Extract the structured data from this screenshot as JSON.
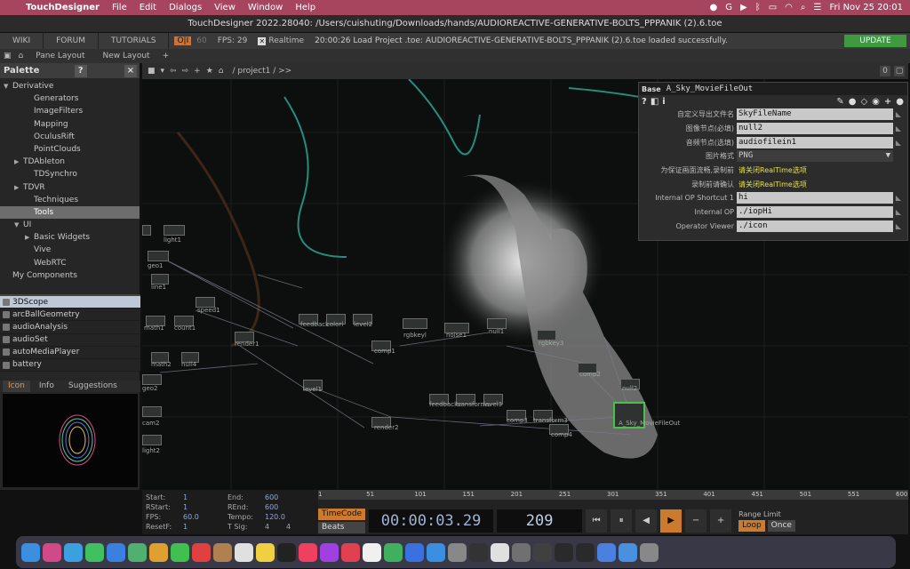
{
  "menubar": {
    "app_name": "TouchDesigner",
    "menus": [
      "File",
      "Edit",
      "Dialogs",
      "View",
      "Window",
      "Help"
    ],
    "clock": "Fri Nov 25  20:01"
  },
  "window": {
    "title": "TouchDesigner 2022.28040: /Users/cuishuting/Downloads/hands/AUDIOREACTIVE-GENERATIVE-BOLTS_PPPANIK (2).6.toe"
  },
  "topbar": {
    "tabs": [
      "WIKI",
      "FORUM",
      "TUTORIALS"
    ],
    "oi_label": "O|I",
    "fps_target": "60",
    "fps_label": "FPS:  29",
    "realtime_label": "Realtime",
    "log": "20:00:26 Load Project .toe: AUDIOREACTIVE-GENERATIVE-BOLTS_PPPANIK (2).6.toe loaded successfully.",
    "update_label": "UPDATE"
  },
  "panebar": {
    "pane_layout": "Pane Layout",
    "new_layout": "New Layout"
  },
  "palette": {
    "title": "Palette",
    "tree": [
      {
        "label": "Derivative",
        "indent": 0,
        "expanded": true
      },
      {
        "label": "Generators",
        "indent": 2
      },
      {
        "label": "ImageFilters",
        "indent": 2
      },
      {
        "label": "Mapping",
        "indent": 2
      },
      {
        "label": "OculusRift",
        "indent": 2
      },
      {
        "label": "PointClouds",
        "indent": 2
      },
      {
        "label": "TDAbleton",
        "indent": 1,
        "collapsed": true
      },
      {
        "label": "TDSynchro",
        "indent": 2
      },
      {
        "label": "TDVR",
        "indent": 1,
        "collapsed": true
      },
      {
        "label": "Techniques",
        "indent": 2
      },
      {
        "label": "Tools",
        "indent": 2,
        "selected": true
      },
      {
        "label": "UI",
        "indent": 1,
        "expanded": true
      },
      {
        "label": "Basic Widgets",
        "indent": 2,
        "collapsed": true
      },
      {
        "label": "Vive",
        "indent": 2
      },
      {
        "label": "WebRTC",
        "indent": 2
      },
      {
        "label": "My Components",
        "indent": 0
      }
    ],
    "components": [
      "3DScope",
      "arcBallGeometry",
      "audioAnalysis",
      "audioSet",
      "autoMediaPlayer",
      "battery"
    ],
    "tabs": [
      "Icon",
      "Info",
      "Suggestions"
    ]
  },
  "network": {
    "path": "/ project1 / >>",
    "nodes": [
      "light1",
      "geo1",
      "line1",
      "speed1",
      "math1",
      "count1",
      "render1",
      "math2",
      "null4",
      "geo2",
      "cam2",
      "light2",
      "feedback",
      "colorl",
      "level2",
      "comp1",
      "level1",
      "rgbkeyl",
      "noise1",
      "null1",
      "rgbkey3",
      "comp2",
      "null2",
      "feedback2",
      "transform1",
      "level3",
      "comp3",
      "transform3",
      "comp4",
      "render2",
      "A_Sky_MovieFileOut"
    ]
  },
  "params": {
    "family": "Base",
    "name": "A_Sky_MovieFileOut",
    "rows": [
      {
        "label": "自定义导出文件名",
        "value": "SkyFileName",
        "kind": "field"
      },
      {
        "label": "图像节点(必填)",
        "value": "null2",
        "kind": "field"
      },
      {
        "label": "音频节点(选填)",
        "value": "audiofilein1",
        "kind": "field"
      },
      {
        "label": "图片格式",
        "value": "PNG",
        "kind": "menu"
      },
      {
        "label": "为保证画面流畅,录制前",
        "value": "请关闭RealTime选项",
        "kind": "text"
      },
      {
        "label": "录制前请确认",
        "value": "请关闭RealTime选项",
        "kind": "text"
      },
      {
        "label": "Internal OP Shortcut 1",
        "value": "hi",
        "kind": "field"
      },
      {
        "label": "Internal OP",
        "value": "./iopHi",
        "kind": "field"
      },
      {
        "label": "Operator Viewer",
        "value": "./icon",
        "kind": "field"
      }
    ]
  },
  "timeline": {
    "start": "1",
    "end": "600",
    "rstart": "1",
    "rend": "600",
    "fps": "60.0",
    "tempo": "120.0",
    "resetf": "1",
    "tsig_a": "4",
    "tsig_b": "4",
    "ruler": [
      "1",
      "51",
      "101",
      "151",
      "201",
      "251",
      "301",
      "351",
      "401",
      "451",
      "501",
      "551",
      "600"
    ],
    "timecode_label": "TimeCode",
    "beats_label": "Beats",
    "timecode": "00:00:03.29",
    "frame": "209",
    "range_limit": "Range Limit",
    "loop": "Loop",
    "once": "Once"
  },
  "dock": [
    "Finder",
    "Launchpad",
    "Safari",
    "Messages",
    "Mail",
    "Maps",
    "Photos",
    "FaceTime",
    "Calendar",
    "Contacts",
    "Reminders",
    "Notes",
    "Apple TV",
    "Music",
    "Podcasts",
    "News",
    "Freeform",
    "Numbers",
    "Keynote",
    "App Store",
    "System Settings",
    "Activity Monitor",
    "Chrome",
    "Screenshots",
    "QuickTime",
    "TouchDesigner",
    "TouchDesigner 2",
    "Preview",
    "Downloads",
    "Trash"
  ]
}
